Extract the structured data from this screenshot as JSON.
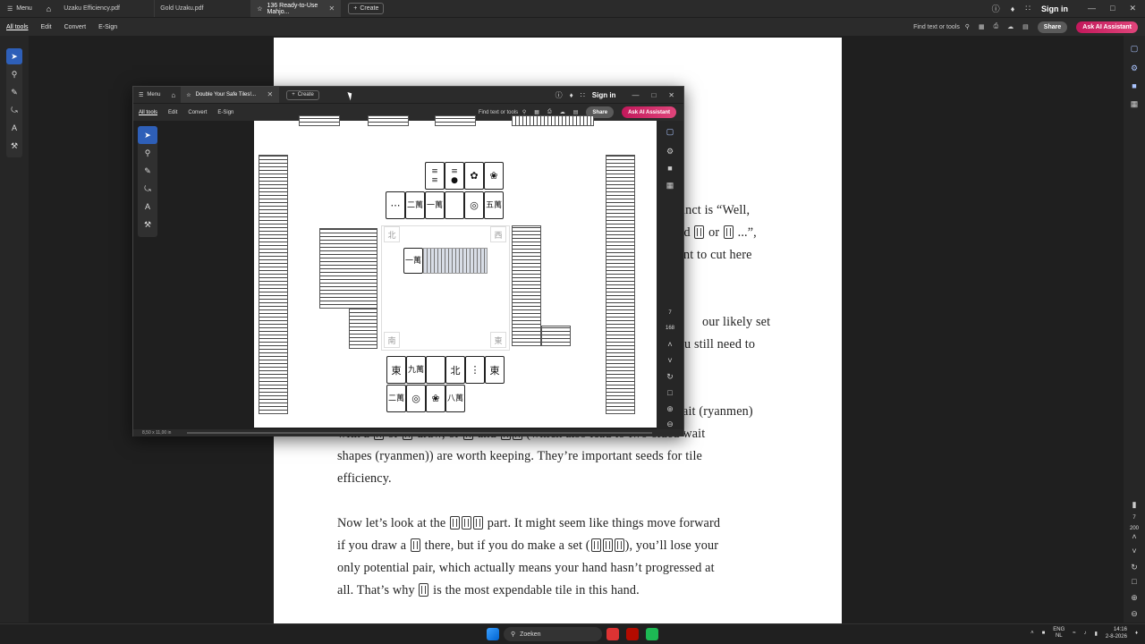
{
  "main": {
    "menu_label": "Menu",
    "tabs": [
      {
        "label": "Uzaku Efficiency.pdf",
        "active": false
      },
      {
        "label": "Gold Uzaku.pdf",
        "active": false
      },
      {
        "label": "136 Ready-to-Use Mahjo...",
        "active": true
      }
    ],
    "create_label": "Create",
    "signin_label": "Sign in",
    "toolbar": {
      "all_tools": "All tools",
      "edit": "Edit",
      "convert": "Convert",
      "esign": "E-Sign",
      "find": "Find text or tools",
      "share": "Share",
      "ai": "Ask AI Assistant"
    },
    "right_rail": {
      "page_num": "7",
      "page_total": "200"
    }
  },
  "document": {
    "lines": [
      "inct is “Well,",
      "ed",
      "or",
      "...”,",
      "nt to cut here",
      "our likely set",
      "u still need to",
      "ait (ryanmen)",
      "with a",
      "or",
      "draw, or",
      "and",
      "(which also lead to two-sided wait",
      "shapes (ryanmen)) are worth keeping. They’re important seeds for tile",
      "efficiency.",
      "Now let’s look at the",
      "part. It might seem like things move forward",
      "if you draw a",
      "there, but if you do make a set (",
      "), you’ll lose your",
      "only potential pair, which actually means your hand hasn’t progressed at",
      "all. That’s why",
      "is the most expendable tile in this hand."
    ]
  },
  "floating": {
    "menu_label": "Menu",
    "tab_label": "Double Your Safe Tiles!...",
    "create_label": "Create",
    "signin_label": "Sign in",
    "toolbar": {
      "all_tools": "All tools",
      "edit": "Edit",
      "convert": "Convert",
      "esign": "E-Sign",
      "find": "Find text or tools",
      "share": "Share",
      "ai": "Ask AI Assistant"
    },
    "status": "8,50 x 11,00 in",
    "page_num": "7",
    "page_total": "168",
    "winds": {
      "north": "北",
      "west": "西",
      "south": "南",
      "east": "東"
    },
    "discard_top_row": [
      "二萬",
      "一萬",
      "五萬",
      "一萬"
    ],
    "hand_row1": [
      "東",
      "九萬",
      "",
      "北",
      "",
      "東"
    ],
    "hand_row2": [
      "二萬",
      "",
      "",
      "八萬"
    ]
  },
  "taskbar": {
    "search_placeholder": "Zoeken",
    "lang_top": "ENG",
    "lang_bottom": "NL",
    "time": "14:16",
    "date": "2-8-2026"
  }
}
